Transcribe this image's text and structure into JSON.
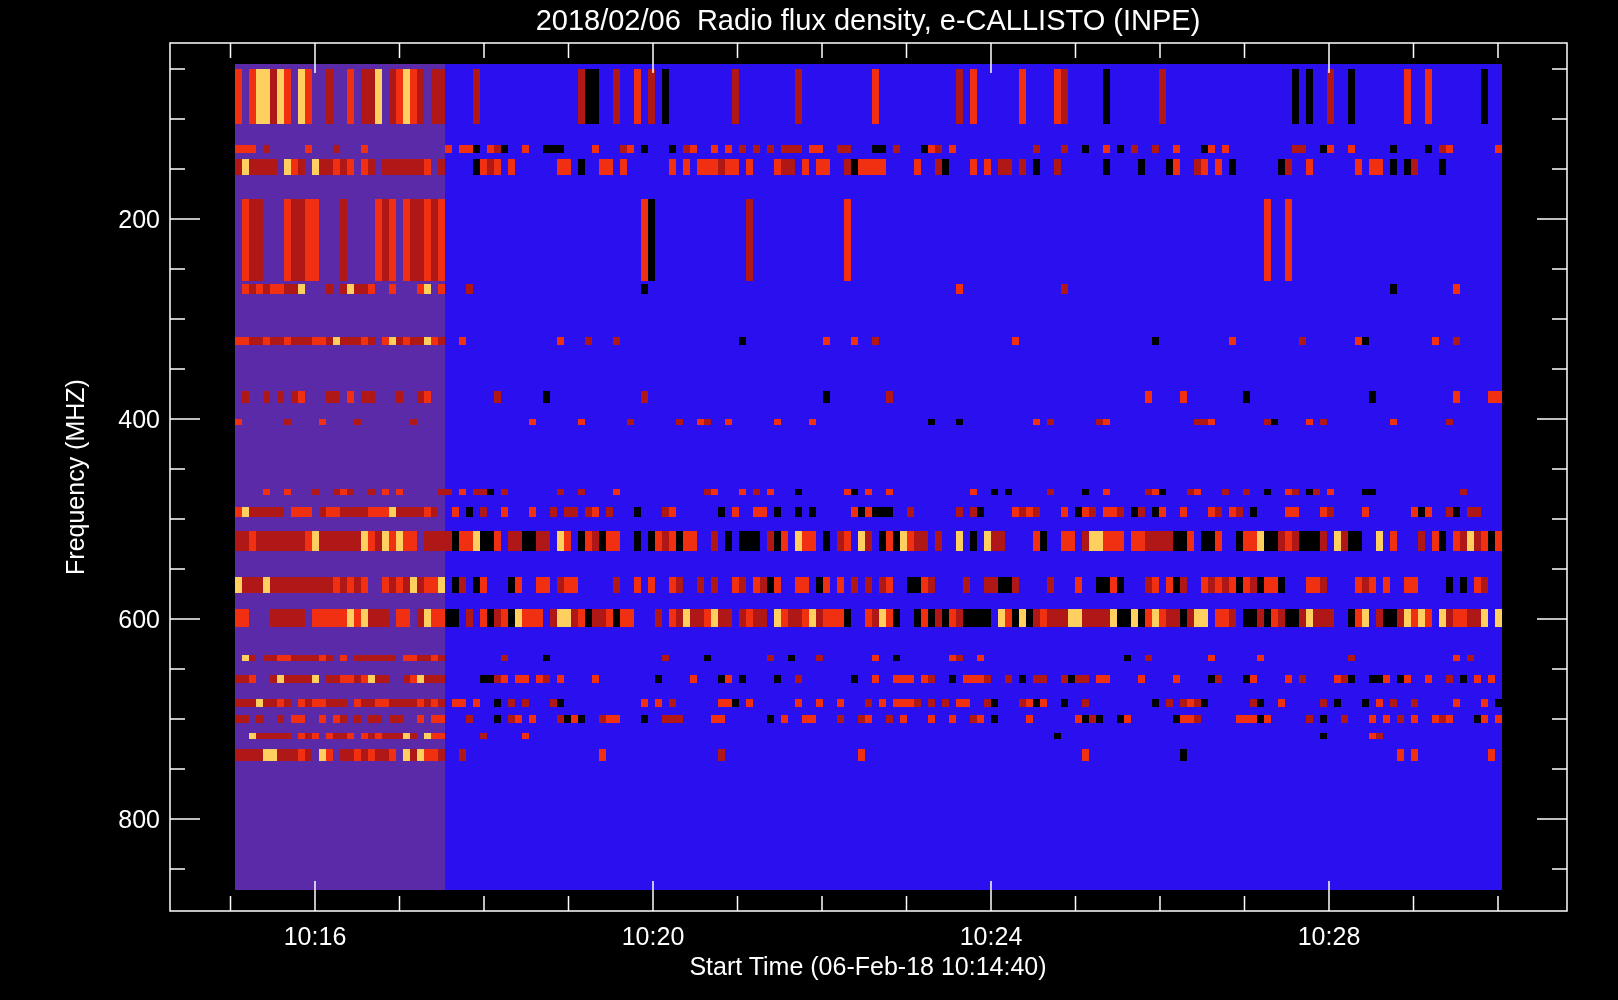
{
  "title": "2018/02/06  Radio flux density, e-CALLISTO (INPE)",
  "y_axis": {
    "label": "Frequency (MHZ)",
    "ticks": [
      "200",
      "400",
      "600",
      "800"
    ]
  },
  "x_axis": {
    "label": "Start Time (06-Feb-18 10:14:40)",
    "ticks": [
      "10:16",
      "10:20",
      "10:24",
      "10:28"
    ]
  }
}
